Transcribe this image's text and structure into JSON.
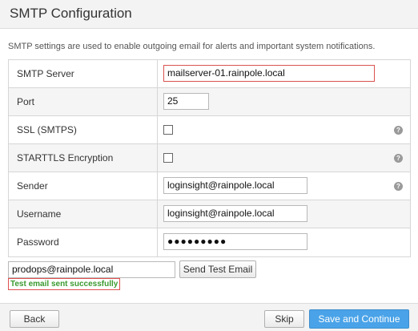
{
  "header": {
    "title": "SMTP Configuration"
  },
  "description": "SMTP settings are used to enable outgoing email for alerts and important system notifications.",
  "form": {
    "smtp_server": {
      "label": "SMTP Server",
      "value": "mailserver-01.rainpole.local"
    },
    "port": {
      "label": "Port",
      "value": "25"
    },
    "ssl": {
      "label": "SSL (SMTPS)",
      "checked": false,
      "help": "?"
    },
    "starttls": {
      "label": "STARTTLS Encryption",
      "checked": false,
      "help": "?"
    },
    "sender": {
      "label": "Sender",
      "value": "loginsight@rainpole.local",
      "help": "?"
    },
    "username": {
      "label": "Username",
      "value": "loginsight@rainpole.local"
    },
    "password": {
      "label": "Password",
      "value": "●●●●●●●●●"
    }
  },
  "test": {
    "email": "prodops@rainpole.local",
    "button_label": "Send Test Email",
    "status": "Test email sent successfully"
  },
  "footer": {
    "back_label": "Back",
    "skip_label": "Skip",
    "save_label": "Save and Continue"
  },
  "colors": {
    "highlight": "#d9534f",
    "success": "#3a9a2f",
    "primary": "#4aa3e8"
  }
}
